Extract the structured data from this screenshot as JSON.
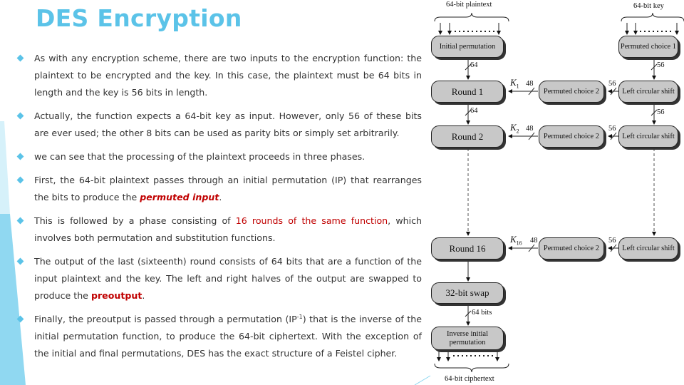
{
  "slide": {
    "title": "DES Encryption",
    "accent_color": "#5bc3e8",
    "highlight_color": "#c00000"
  },
  "bullets": [
    {
      "parts": [
        {
          "text": " As with any encryption scheme, there are two inputs to the encryption function: the plaintext to be encrypted and the key. In this case, the plaintext must be 64 bits in length and the key is 56 bits in length."
        }
      ]
    },
    {
      "parts": [
        {
          "text": " Actually, the function expects a 64-bit key as input. However, only 56 of these bits are ever used; the other 8 bits can be used as parity bits or simply set arbitrarily."
        }
      ]
    },
    {
      "parts": [
        {
          "text": "we can see that the processing of the plaintext proceeds in three phases."
        }
      ]
    },
    {
      "parts": [
        {
          "text": "First, the 64-bit plaintext passes through an initial permutation (IP) that rearranges the bits to produce the "
        },
        {
          "text": "permuted input",
          "style": "bold-italic"
        },
        {
          "text": "."
        }
      ]
    },
    {
      "parts": [
        {
          "text": "This is followed by a phase consisting of "
        },
        {
          "text": "16 rounds of the same function",
          "style": "red"
        },
        {
          "text": ", which involves both permutation and substitution functions."
        }
      ]
    },
    {
      "parts": [
        {
          "text": "The output of the last (sixteenth) round consists of 64 bits that are a function of the input plaintext and the key. The left and right halves of the output are swapped to produce the "
        },
        {
          "text": "preoutput",
          "style": "bold"
        },
        {
          "text": "."
        }
      ]
    },
    {
      "parts": [
        {
          "text": "Finally, the preoutput is passed through a permutation (IP"
        },
        {
          "text": "-1",
          "style": "sup"
        },
        {
          "text": ") that is the inverse of the initial permutation function, to produce the 64-bit ciphertext. With the exception of the initial and final permutations, DES has the exact structure of a Feistel cipher."
        }
      ]
    }
  ],
  "diagram": {
    "plaintext_label": "64-bit plaintext",
    "key_label": "64-bit key",
    "ciphertext_label": "64-bit ciphertext",
    "initial_permutation": "Initial permutation",
    "permuted_choice_1": "Permuted choice 1",
    "round1": "Round 1",
    "round2": "Round 2",
    "round16": "Round 16",
    "pc2_label": "Permuted choice 2",
    "lcs_label": "Left circular shift",
    "swap": "32-bit swap",
    "inverse_ip_line1": "Inverse initial",
    "inverse_ip_line2": "permutation",
    "k1": "K",
    "k1_sub": "1",
    "k2": "K",
    "k2_sub": "2",
    "k16": "K",
    "k16_sub": "16",
    "bits_64": "64",
    "bits_56": "56",
    "bits_48": "48",
    "bits_64_bits": "64 bits"
  }
}
